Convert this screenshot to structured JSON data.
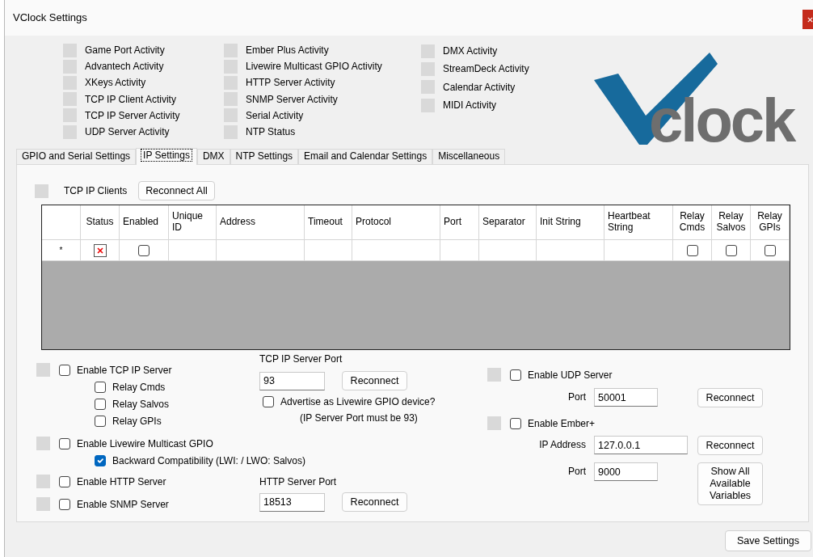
{
  "window": {
    "title": "VClock Settings"
  },
  "activity_columns": [
    [
      {
        "label": "Game Port Activity",
        "active": false
      },
      {
        "label": "Advantech Activity",
        "active": false
      },
      {
        "label": "XKeys Activity",
        "active": false
      },
      {
        "label": "TCP IP Client Activity",
        "active": false
      },
      {
        "label": "TCP IP Server Activity",
        "active": false
      },
      {
        "label": "UDP Server Activity",
        "active": false
      }
    ],
    [
      {
        "label": "Ember Plus Activity",
        "active": false
      },
      {
        "label": "Livewire Multicast GPIO Activity",
        "active": false
      },
      {
        "label": "HTTP Server Activity",
        "active": false
      },
      {
        "label": "SNMP Server Activity",
        "active": false
      },
      {
        "label": "Serial Activity",
        "active": false
      },
      {
        "label": "NTP Status",
        "active": false
      }
    ],
    [
      {
        "label": "DMX Activity",
        "active": false
      },
      {
        "label": "StreamDeck Activity",
        "active": false
      },
      {
        "label": "Calendar Activity",
        "active": false
      },
      {
        "label": "MIDI Activity",
        "active": false
      }
    ]
  ],
  "logo": {
    "text": "clock"
  },
  "tabs": [
    {
      "label": "GPIO and Serial Settings",
      "selected": false
    },
    {
      "label": "IP Settings",
      "selected": true
    },
    {
      "label": "DMX",
      "selected": false
    },
    {
      "label": "NTP Settings",
      "selected": false
    },
    {
      "label": "Email and Calendar Settings",
      "selected": false
    },
    {
      "label": "Miscellaneous",
      "selected": false
    }
  ],
  "tcp_clients": {
    "active": false,
    "label": "TCP IP Clients",
    "button": "Reconnect All"
  },
  "grid": {
    "columns": [
      "Status",
      "Enabled",
      "Unique ID",
      "Address",
      "Timeout",
      "Protocol",
      "Port",
      "Separator",
      "Init String",
      "Heartbeat String",
      "Relay Cmds",
      "Relay Salvos",
      "Relay GPIs"
    ],
    "new_row": {
      "marker": "*",
      "cells": [
        {
          "kind": "image"
        },
        {
          "kind": "checkbox",
          "checked": false
        },
        {
          "kind": "text"
        },
        {
          "kind": "text"
        },
        {
          "kind": "text"
        },
        {
          "kind": "text"
        },
        {
          "kind": "text"
        },
        {
          "kind": "text"
        },
        {
          "kind": "text"
        },
        {
          "kind": "text"
        },
        {
          "kind": "checkbox",
          "checked": false
        },
        {
          "kind": "checkbox",
          "checked": false
        },
        {
          "kind": "checkbox",
          "checked": false
        }
      ]
    }
  },
  "tcp_server": {
    "active": false,
    "enable": {
      "label": "Enable TCP IP Server",
      "checked": false
    },
    "relay_options": [
      {
        "label": "Relay Cmds",
        "checked": false
      },
      {
        "label": "Relay Salvos",
        "checked": false
      },
      {
        "label": "Relay GPIs",
        "checked": false
      }
    ],
    "port_label": "TCP IP Server Port",
    "port": "93",
    "reconnect": "Reconnect",
    "advertise": {
      "label": "Advertise as Livewire GPIO device?",
      "checked": false
    },
    "note": "(IP Server Port must be 93)"
  },
  "livewire": {
    "active": false,
    "enable": {
      "label": "Enable Livewire Multicast GPIO",
      "checked": false
    },
    "backward": {
      "label": "Backward Compatibility (LWI: / LWO: Salvos)",
      "checked": true
    }
  },
  "http_server": {
    "active": false,
    "enable": {
      "label": "Enable HTTP Server",
      "checked": false
    },
    "port_label": "HTTP Server Port",
    "port": "18513",
    "reconnect": "Reconnect"
  },
  "snmp_server": {
    "active": false,
    "enable": {
      "label": "Enable SNMP Server",
      "checked": false
    }
  },
  "udp_server": {
    "active": false,
    "enable": {
      "label": "Enable UDP Server",
      "checked": false
    },
    "port_label": "Port",
    "port": "50001",
    "reconnect": "Reconnect"
  },
  "ember": {
    "active": false,
    "enable": {
      "label": "Enable Ember+",
      "checked": false
    },
    "ip_label": "IP Address",
    "ip": "127.0.0.1",
    "reconnect": "Reconnect",
    "port_label": "Port",
    "port": "9000",
    "show_variables": "Show All Available Variables"
  },
  "footer": {
    "save": "Save Settings"
  }
}
